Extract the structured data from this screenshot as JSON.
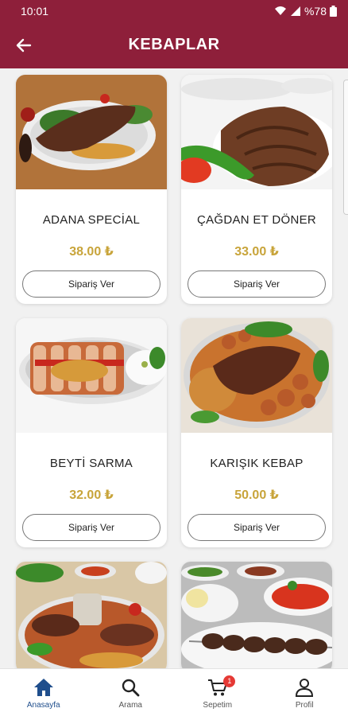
{
  "status_bar": {
    "time": "10:01",
    "battery": "%78"
  },
  "header": {
    "title": "KEBAPLAR"
  },
  "products": [
    {
      "name": "ADANA SPECİAL",
      "price": "38.00 ₺",
      "button": "Sipariş Ver"
    },
    {
      "name": "ÇAĞDAN ET DÖNER",
      "price": "33.00 ₺",
      "button": "Sipariş Ver"
    },
    {
      "name": "BEYTİ SARMA",
      "price": "32.00 ₺",
      "button": "Sipariş Ver"
    },
    {
      "name": "KARIŞIK KEBAP",
      "price": "50.00 ₺",
      "button": "Sipariş Ver"
    }
  ],
  "bottom_nav": {
    "home": "Anasayfa",
    "search": "Arama",
    "cart": "Sepetim",
    "cart_badge": "1",
    "profile": "Profil"
  },
  "colors": {
    "primary": "#8e1f3a",
    "price": "#c8a43a",
    "active_tab": "#1f4e8c",
    "badge": "#e53935"
  }
}
